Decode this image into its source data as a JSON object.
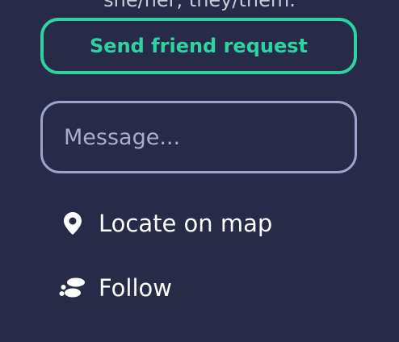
{
  "profile": {
    "pronouns": "she/her, they/them."
  },
  "actions": {
    "send_friend_request_label": "Send friend request",
    "message_placeholder": "Message...",
    "locate_label": "Locate on map",
    "follow_label": "Follow",
    "locate_icon": "map-pin-icon",
    "follow_icon": "footsteps-icon"
  },
  "colors": {
    "background": "#272b48",
    "accent": "#2fd3a1",
    "input_border": "#9da4c9",
    "text": "#ffffff"
  }
}
